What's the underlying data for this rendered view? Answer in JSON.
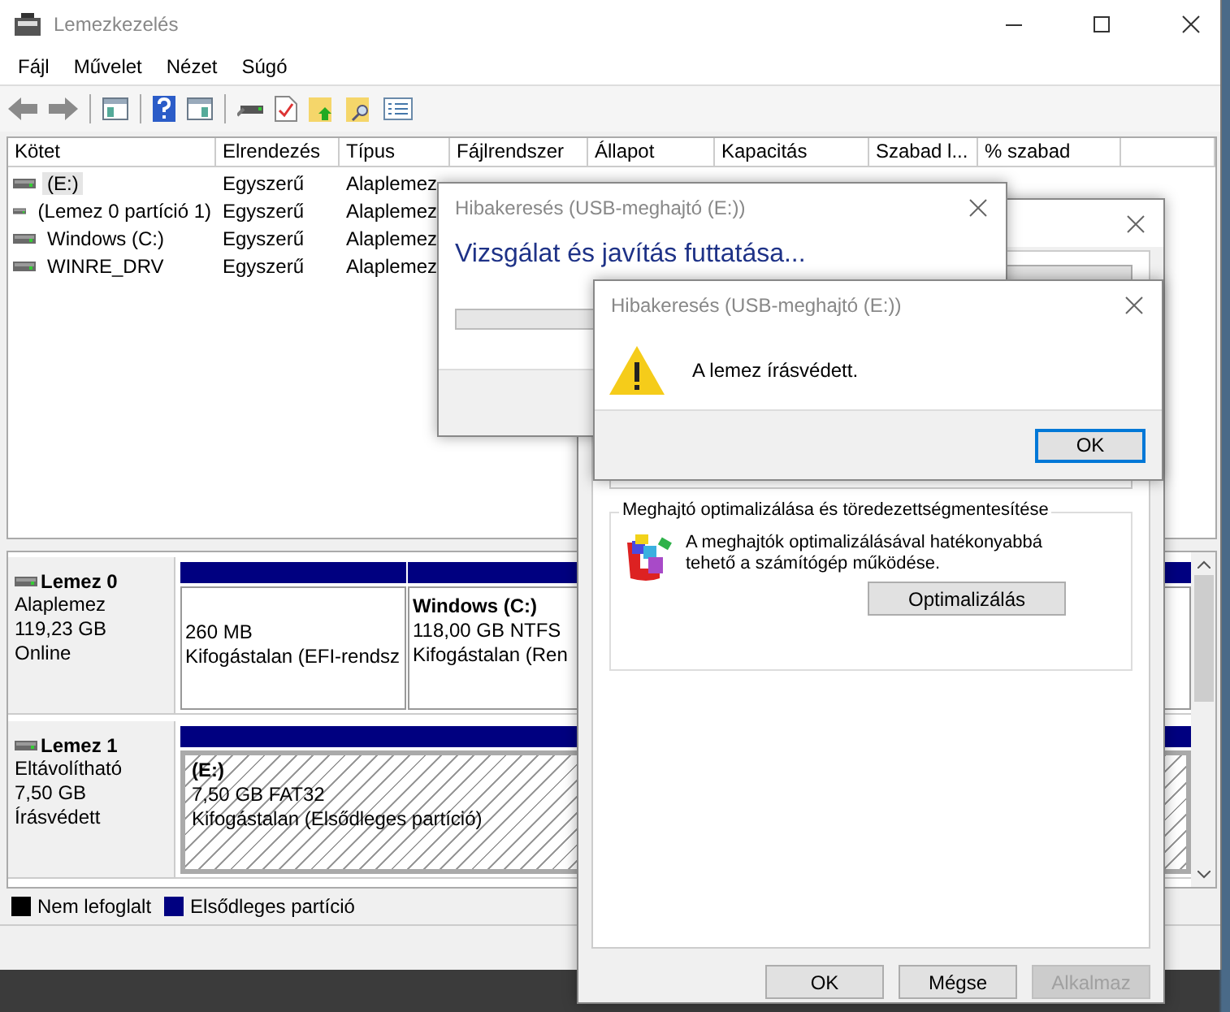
{
  "window": {
    "title": "Lemezkezelés"
  },
  "menu": [
    "Fájl",
    "Művelet",
    "Nézet",
    "Súgó"
  ],
  "volume_table": {
    "columns": [
      "Kötet",
      "Elrendezés",
      "Típus",
      "Fájlrendszer",
      "Állapot",
      "Kapacitás",
      "Szabad l...",
      "% szabad"
    ],
    "rows": [
      {
        "cells": [
          "(E:)",
          "Egyszerű",
          "Alaplemez"
        ],
        "selected": true
      },
      {
        "cells": [
          "(Lemez 0 partíció 1)",
          "Egyszerű",
          "Alaplemez"
        ],
        "selected": false
      },
      {
        "cells": [
          "Windows (C:)",
          "Egyszerű",
          "Alaplemez"
        ],
        "selected": false
      },
      {
        "cells": [
          "WINRE_DRV",
          "Egyszerű",
          "Alaplemez"
        ],
        "selected": false
      }
    ]
  },
  "disks": [
    {
      "name": "Lemez 0",
      "details": [
        "Alaplemez",
        "119,23 GB",
        "Online"
      ],
      "partitions": [
        {
          "lines": [
            "260 MB",
            "Kifogástalan (EFI-rendsz"
          ],
          "selected": false
        },
        {
          "title": "Windows  (C:)",
          "lines": [
            "118,00 GB NTFS",
            "Kifogástalan (Ren"
          ],
          "selected": false
        }
      ]
    },
    {
      "name": "Lemez 1",
      "details": [
        "Eltávolítható",
        "7,50 GB",
        "Írásvédett"
      ],
      "partitions": [
        {
          "title": "(E:)",
          "lines": [
            "7,50 GB FAT32",
            "Kifogástalan (Elsődleges partíció)"
          ],
          "selected": true
        }
      ]
    }
  ],
  "legend": [
    {
      "label": "Nem lefoglalt",
      "color": "#000000"
    },
    {
      "label": "Elsődleges partíció",
      "color": "#000080"
    }
  ],
  "properties_dialog": {
    "group_title": "Meghajtó optimalizálása és töredezettségmentesítése",
    "description": "A meghajtók optimalizálásával hatékonyabbá tehető a számítógép működése.",
    "action": "Optimalizálás",
    "buttons": [
      {
        "label": "OK",
        "disabled": false
      },
      {
        "label": "Mégse",
        "disabled": false
      },
      {
        "label": "Alkalmaz",
        "disabled": true
      }
    ]
  },
  "scan_dialog": {
    "title": "Hibakeresés (USB-meghajtó (E:))",
    "heading": "Vizsgálat és javítás futtatása...",
    "level": 0
  },
  "error_dialog": {
    "title": "Hibakeresés (USB-meghajtó (E:))",
    "message": "A lemez írásvédett.",
    "buttons": [
      {
        "label": "OK",
        "focused": true
      }
    ]
  }
}
